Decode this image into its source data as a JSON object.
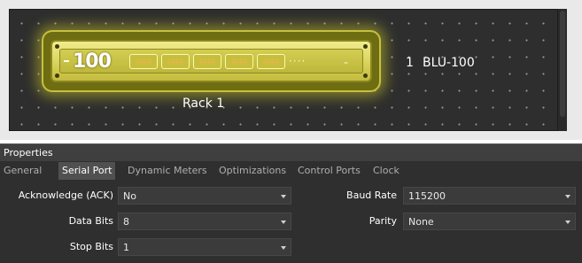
{
  "canvas": {
    "rack": {
      "model_label": "100",
      "label": "Rack 1",
      "empty_slots": "····"
    },
    "device": {
      "number": "1",
      "name": "BLU-100"
    }
  },
  "properties": {
    "title": "Properties",
    "tabs": [
      {
        "label": "General"
      },
      {
        "label": "Serial Port",
        "active": true
      },
      {
        "label": "Dynamic Meters"
      },
      {
        "label": "Optimizations"
      },
      {
        "label": "Control Ports"
      },
      {
        "label": "Clock"
      }
    ],
    "fields": {
      "acknowledge": {
        "label": "Acknowledge (ACK)",
        "value": "No"
      },
      "data_bits": {
        "label": "Data Bits",
        "value": "8"
      },
      "stop_bits": {
        "label": "Stop Bits",
        "value": "1"
      },
      "baud_rate": {
        "label": "Baud Rate",
        "value": "115200"
      },
      "parity": {
        "label": "Parity",
        "value": "None"
      }
    }
  },
  "colors": {
    "rack_glow": "#c7c040",
    "canvas_bg": "#2e2e2e",
    "panel_bg": "#2f2f2f",
    "active_tab": "#505050"
  }
}
